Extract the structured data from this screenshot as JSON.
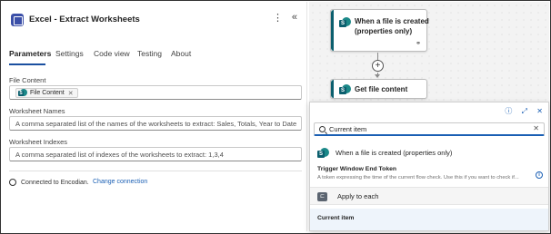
{
  "panel": {
    "title": "Excel - Extract Worksheets",
    "more_glyph": "⋮",
    "collapse_glyph": "«",
    "tabs": [
      "Parameters",
      "Settings",
      "Code view",
      "Testing",
      "About"
    ],
    "active_tab": "Parameters"
  },
  "fields": {
    "file_content": {
      "label": "File Content",
      "token": "File Content"
    },
    "worksheet_names": {
      "label": "Worksheet Names",
      "placeholder": "A comma separated list of the names of the worksheets to extract: Sales, Totals, Year to Date"
    },
    "worksheet_indexes": {
      "label": "Worksheet Indexes",
      "placeholder": "A comma separated list of indexes of the worksheets to extract: 1,3,4"
    }
  },
  "connection": {
    "text": "Connected to Encodian.",
    "change_link": "Change connection"
  },
  "canvas": {
    "trigger_card": {
      "title_line1": "When a file is created",
      "title_line2": "(properties only)",
      "link_glyph": "⚭"
    },
    "add_glyph": "+",
    "action_card": {
      "title": "Get file content"
    }
  },
  "popup": {
    "icons": {
      "info": "ⓘ",
      "expand": "⤢",
      "close": "✕"
    },
    "search_value": "Current item",
    "clear_glyph": "✕",
    "trigger_section": "When a file is created (properties only)",
    "token_name": "Trigger Window End Token",
    "token_description": "A token expressing the time of the current flow check. Use this if you want to check if...",
    "info_glyph": "i",
    "apply_label": "Apply to each",
    "apply_icon_glyph": "⊏",
    "current_item": "Current item"
  },
  "colors": {
    "accent_blue": "#1a4fa0",
    "sharepoint_teal": "#0b5f6e",
    "link_blue": "#1a5fb4"
  }
}
